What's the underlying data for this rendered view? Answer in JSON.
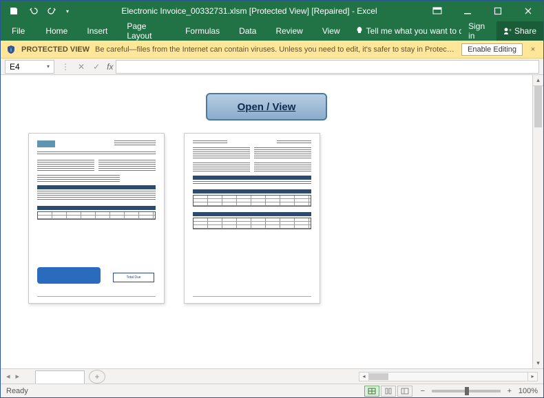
{
  "titlebar": {
    "title": "Electronic Invoice_00332731.xlsm  [Protected View] [Repaired] - Excel"
  },
  "ribbon": {
    "file": "File",
    "tabs": [
      "Home",
      "Insert",
      "Page Layout",
      "Formulas",
      "Data",
      "Review",
      "View"
    ],
    "tellme": "Tell me what you want to do...",
    "signin": "Sign in",
    "share": "Share"
  },
  "protected_view": {
    "title": "PROTECTED VIEW",
    "message": "Be careful—files from the Internet can contain viruses. Unless you need to edit, it's safer to stay in Protected View.",
    "enable_label": "Enable Editing"
  },
  "formula_bar": {
    "name_box": "E4",
    "fx_label": "fx",
    "formula": ""
  },
  "sheet_content": {
    "open_view_label": "Open / View",
    "page2_total_label": "Total Due"
  },
  "tabstrip": {
    "sheet_name": "",
    "add_tip": "+"
  },
  "statusbar": {
    "ready": "Ready",
    "zoom_pct": "100%"
  }
}
